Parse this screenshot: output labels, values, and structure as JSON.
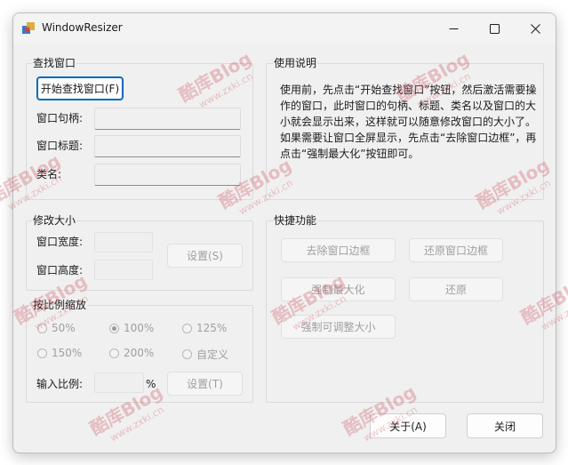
{
  "window": {
    "title": "WindowResizer",
    "caption": {
      "minimize": "minimize",
      "maximize": "maximize",
      "close": "close"
    }
  },
  "find_group": {
    "title": "查找窗口",
    "start_button": "开始查找窗口(F)",
    "handle_label": "窗口句柄:",
    "title_label": "窗口标题:",
    "class_label": "类名:",
    "handle_value": "",
    "title_value": "",
    "class_value": ""
  },
  "usage_group": {
    "title": "使用说明",
    "paragraph1": "使用前，先点击“开始查找窗口”按钮，然后激活需要操作的窗口，此时窗口的句柄、标题、类名以及窗口的大小就会显示出来，这样就可以随意修改窗口的大小了。",
    "paragraph2": "如果需要让窗口全屏显示，先点击“去除窗口边框”，再点击“强制最大化”按钮即可。"
  },
  "resize_group": {
    "title": "修改大小",
    "width_label": "窗口宽度:",
    "height_label": "窗口高度:",
    "set_button": "设置(S)"
  },
  "scale_group": {
    "title": "按比例缩放",
    "options": [
      "50%",
      "100%",
      "125%",
      "150%",
      "200%",
      "自定义"
    ],
    "selected": "100%",
    "ratio_label": "输入比例:",
    "percent_sign": "%",
    "set_button": "设置(T)"
  },
  "quick_group": {
    "title": "快捷功能",
    "remove_border": "去除窗口边框",
    "restore_border": "还原窗口边框",
    "force_maximize": "强制最大化",
    "restore": "还原",
    "force_resizable": "强制可调整大小"
  },
  "footer": {
    "about_button": "关于(A)",
    "close_button": "关闭"
  },
  "watermark": {
    "brand": "酷库Blog",
    "url": "www.zxki.cn"
  },
  "colors": {
    "window_bg": "#f0f0f0",
    "focus_accent": "#0067c0",
    "watermark": "#d25f69"
  }
}
